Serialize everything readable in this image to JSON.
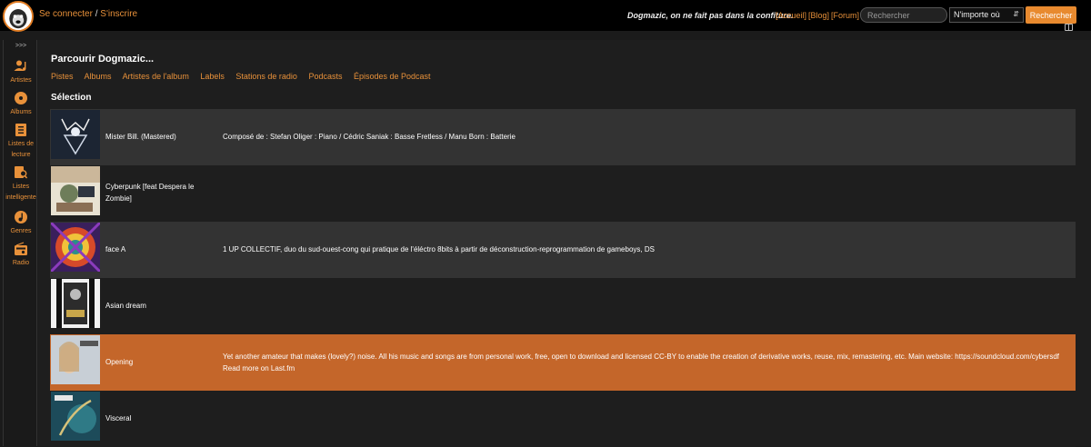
{
  "header": {
    "login_label": "Se connecter",
    "separator": "/",
    "signup_label": "S'inscrire",
    "tagline": "Dogmazic, on ne fait pas dans la confiture.",
    "links": [
      "[Accueil]",
      "[Blog]",
      "[Forum]"
    ],
    "search_placeholder": "Rechercher",
    "search_scope": "N'importe où",
    "search_button": "Rechercher"
  },
  "sidebar": {
    "expand_label": ">>>",
    "items": [
      {
        "label": "Artistes",
        "icon": "artists-icon"
      },
      {
        "label": "Albums",
        "icon": "albums-icon"
      },
      {
        "label": "Listes de lecture",
        "icon": "playlists-icon"
      },
      {
        "label": "Listes intelligente",
        "icon": "smartlists-icon"
      },
      {
        "label": "Genres",
        "icon": "genres-icon"
      },
      {
        "label": "Radio",
        "icon": "radio-icon"
      }
    ]
  },
  "main": {
    "title": "Parcourir Dogmazic...",
    "tabs": [
      "Pistes",
      "Albums",
      "Artistes de l'album",
      "Labels",
      "Stations de radio",
      "Podcasts",
      "Épisodes de Podcast"
    ],
    "section_title": "Sélection",
    "rows": [
      {
        "title": "Mister Bill. (Mastered)",
        "description": "Composé de : Stefan Oliger : Piano / Cédric Saniak : Basse Fretless / Manu Born : Batterie"
      },
      {
        "title": "Cyberpunk [feat Despera le Zombie]",
        "description": ""
      },
      {
        "title": "face A",
        "description": "1 UP COLLECTIF, duo du sud-ouest-cong qui pratique de l'éléctro 8bits à partir de déconstruction-reprogrammation de gameboys, DS"
      },
      {
        "title": "Asian dream",
        "description": ""
      },
      {
        "title": "Opening",
        "description": "Yet another amateur that makes (lovely?) noise. All his music and songs are from personal work, free, open to download and licensed CC-BY to enable the creation of derivative works, reuse, mix, remastering, etc. Main website: https://soundcloud.com/cybersdf Read more on Last.fm"
      },
      {
        "title": "Visceral",
        "description": ""
      }
    ]
  },
  "colors": {
    "accent": "#e8913a",
    "active_row": "#c4662a",
    "odd_row": "#333333",
    "topbar": "#000000"
  }
}
